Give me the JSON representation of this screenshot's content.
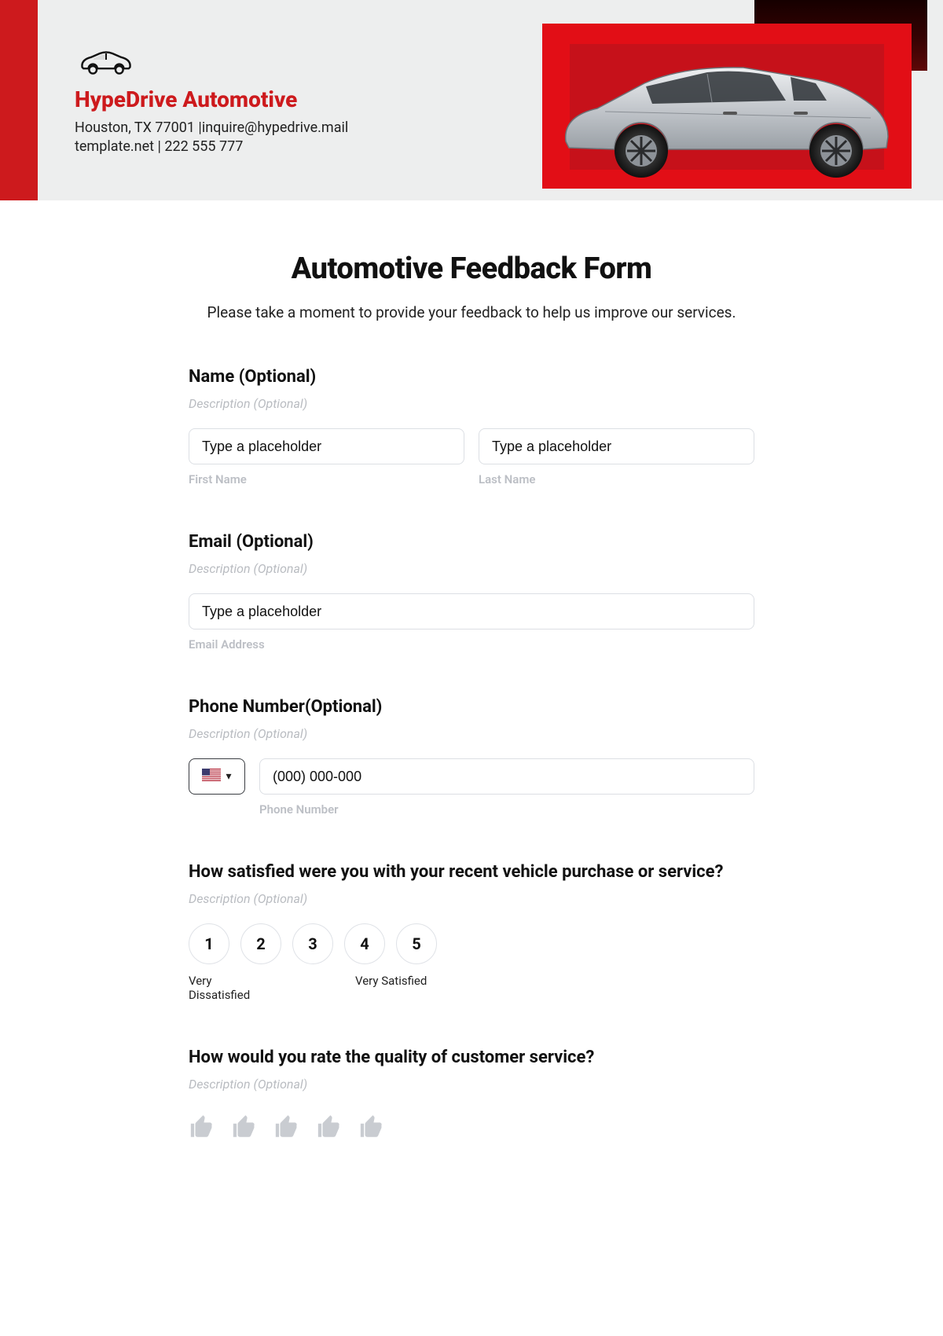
{
  "header": {
    "brand_name": "HypeDrive Automotive",
    "address_line1": "Houston, TX 77001 |inquire@hypedrive.mail",
    "address_line2": "template.net | 222 555 777"
  },
  "form": {
    "title": "Automotive Feedback Form",
    "intro": "Please take a moment to provide your feedback to help us improve our services."
  },
  "name_section": {
    "label": "Name (Optional)",
    "desc": "Description (Optional)",
    "first_placeholder": "Type a placeholder",
    "last_placeholder": "Type a placeholder",
    "first_sub": "First Name",
    "last_sub": "Last Name"
  },
  "email_section": {
    "label": "Email (Optional)",
    "desc": "Description (Optional)",
    "placeholder": "Type a placeholder",
    "sub": "Email Address"
  },
  "phone_section": {
    "label": "Phone Number(Optional)",
    "desc": "Description (Optional)",
    "placeholder": "(000) 000-000",
    "sub": "Phone Number"
  },
  "satisfaction_section": {
    "label": "How satisfied were you with your recent vehicle purchase or service?",
    "desc": "Description (Optional)",
    "options": [
      "1",
      "2",
      "3",
      "4",
      "5"
    ],
    "anchor_low": "Very Dissatisfied",
    "anchor_high": "Very Satisfied"
  },
  "service_quality_section": {
    "label": "How would you rate the quality of customer service?",
    "desc": "Description (Optional)"
  }
}
